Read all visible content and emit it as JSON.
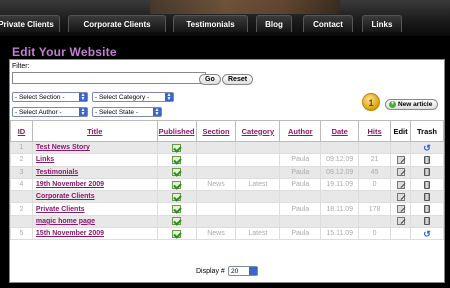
{
  "nav": {
    "tabs": [
      {
        "label": "Private Clients"
      },
      {
        "label": "Corporate Clients"
      },
      {
        "label": "Testimonials"
      },
      {
        "label": "Blog"
      },
      {
        "label": "Contact"
      },
      {
        "label": "Links"
      }
    ]
  },
  "page": {
    "title": "Edit Your Website"
  },
  "filter": {
    "label": "Filter:",
    "input_value": "",
    "go_label": "Go",
    "reset_label": "Reset",
    "section_select": "- Select Section -",
    "category_select": "- Select Category -",
    "author_select": "- Select Author -",
    "state_select": "- Select State -"
  },
  "badge": {
    "number": "1"
  },
  "new_article": {
    "label": "New article",
    "icon": "plus-circle-icon"
  },
  "table": {
    "headers": {
      "id": "ID",
      "title": "Title",
      "published": "Published",
      "section": "Section",
      "category": "Category",
      "author": "Author",
      "date": "Date",
      "hits": "Hits",
      "edit": "Edit",
      "trash": "Trash"
    },
    "rows": [
      {
        "id": "1",
        "title": "Test News Story",
        "section": "",
        "category": "",
        "author": "",
        "date": "",
        "hits": "",
        "trash_icon": "restore"
      },
      {
        "id": "2",
        "title": "Links",
        "section": "",
        "category": "",
        "author": "Paula",
        "date": "09.12.09",
        "hits": "21",
        "trash_icon": "trash"
      },
      {
        "id": "3",
        "title": "Testimonials",
        "section": "",
        "category": "",
        "author": "Paula",
        "date": "09.12.09",
        "hits": "45",
        "trash_icon": "trash"
      },
      {
        "id": "4",
        "title": "19th November 2009",
        "section": "News",
        "category": "Latest",
        "author": "Paula",
        "date": "19.11.09",
        "hits": "0",
        "trash_icon": "trash"
      },
      {
        "id": "",
        "title": "Corporate Clients",
        "section": "",
        "category": "",
        "author": "",
        "date": "",
        "hits": "",
        "trash_icon": "trash"
      },
      {
        "id": "2",
        "title": "Private Clients",
        "section": "",
        "category": "",
        "author": "Paula",
        "date": "18.11.09",
        "hits": "178",
        "trash_icon": "trash"
      },
      {
        "id": "",
        "title": "magic home page",
        "section": "",
        "category": "",
        "author": "",
        "date": "",
        "hits": "",
        "trash_icon": "trash"
      },
      {
        "id": "5",
        "title": "15th November 2009",
        "section": "News",
        "category": "Latest",
        "author": "Paula",
        "date": "15.11.09",
        "hits": "0",
        "trash_icon": "restore"
      }
    ]
  },
  "footer": {
    "display_label": "Display #",
    "display_value": "20"
  }
}
